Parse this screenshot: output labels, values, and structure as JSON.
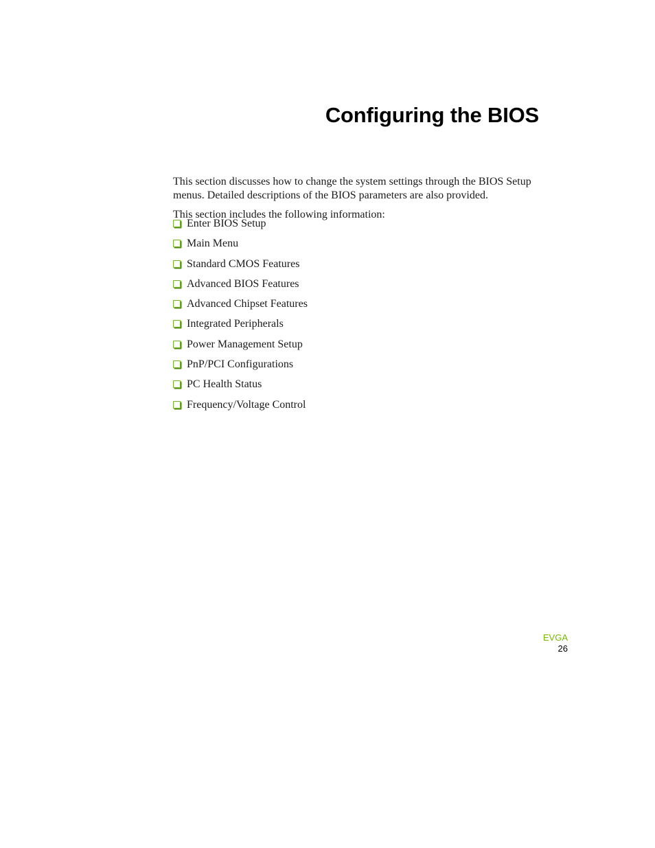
{
  "page": {
    "title": "Configuring the BIOS",
    "intro_paragraph": "This section discusses how to change the system settings through the BIOS Setup menus. Detailed descriptions of the BIOS parameters are also provided.",
    "list_intro": "This section includes the following information:",
    "bullet_icon": "checkbox-square-icon",
    "accent_color": "#76b900",
    "items": [
      "Enter BIOS Setup",
      "Main Menu",
      "Standard CMOS Features",
      "Advanced BIOS Features",
      "Advanced Chipset Features",
      "Integrated Peripherals",
      "Power Management Setup",
      "PnP/PCI Configurations",
      "PC Health Status",
      "Frequency/Voltage Control"
    ]
  },
  "footer": {
    "brand": "EVGA",
    "page_number": "26"
  }
}
